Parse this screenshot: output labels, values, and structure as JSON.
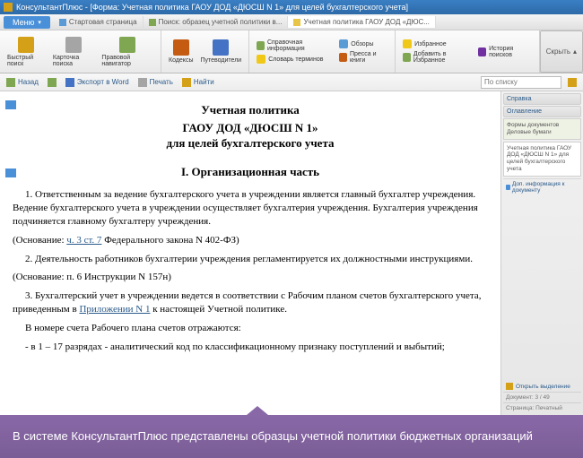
{
  "title": "КонсультантПлюс - [Форма: Учетная политика ГАОУ ДОД «ДЮСШ N 1» для целей бухгалтерского учета]",
  "menu": {
    "label": "Меню"
  },
  "tabs": [
    {
      "label": "Стартовая страница"
    },
    {
      "label": "Поиск: образец учетной политики в..."
    },
    {
      "label": "Учетная политика ГАОУ ДОД «ДЮС..."
    }
  ],
  "ribbon": {
    "quick_search": "Быстрый поиск",
    "card": "Карточка поиска",
    "nav": "Правовой навигатор",
    "codex": "Кодексы",
    "guides": "Путеводители",
    "ref": "Справочная информация",
    "reviews": "Обзоры",
    "dict": "Словарь терминов",
    "press": "Пресса и книги",
    "fav": "Избранное",
    "history": "История поисков",
    "add_fav": "Добавить в Избранное",
    "hide": "Скрыть"
  },
  "subbar": {
    "back": "Назад",
    "export": "Экспорт в Word",
    "print": "Печать",
    "find": "Найти",
    "search_placeholder": "По списку"
  },
  "document": {
    "heading1": "Учетная политика",
    "heading2": "ГАОУ ДОД «ДЮСШ N 1»",
    "heading3": "для целей бухгалтерского учета",
    "section": "I. Организационная часть",
    "p1": "1. Ответственным за ведение бухгалтерского учета в учреждении является главный бухгалтер учреждения. Ведение бухгалтерского учета в учреждении осуществляет бухгалтерия учреждения. Бухгалтерия учреждения подчиняется главному бухгалтеру учреждения.",
    "p1_basis_pre": "(Основание: ",
    "p1_link": "ч. 3 ст. 7",
    "p1_basis_post": " Федерального закона N 402-ФЗ)",
    "p2": "2. Деятельность работников бухгалтерии учреждения регламентируется их должностными инструкциями.",
    "p2_basis": "(Основание: п. 6 Инструкции N 157н)",
    "p3_pre": "3. Бухгалтерский учет в учреждении ведется в соответствии с Рабочим планом счетов бухгалтерского учета, приведенным в ",
    "p3_link": "Приложении N 1",
    "p3_post": " к настоящей Учетной политике.",
    "p4": "В номере счета Рабочего плана счетов отражаются:",
    "p5": "- в 1 – 17 разрядах - аналитический код по классификационному признаку поступлений и выбытий;"
  },
  "sidebar": {
    "ref": "Справка",
    "toc": "Оглавление",
    "forms_hdr": "Формы документов Деловые бумаги",
    "doc_desc": "Учетная политика ГАОУ ДОД «ДЮСШ N 1» для целей бухгалтерского учета",
    "info_link": "Доп. информация к документу",
    "open": "Открыть выделение",
    "status": "Документ:  3 / 49",
    "status2": "Страница:   Печатный"
  },
  "banner": "В системе КонсультантПлюс представлены образцы учетной политики бюджетных организаций"
}
